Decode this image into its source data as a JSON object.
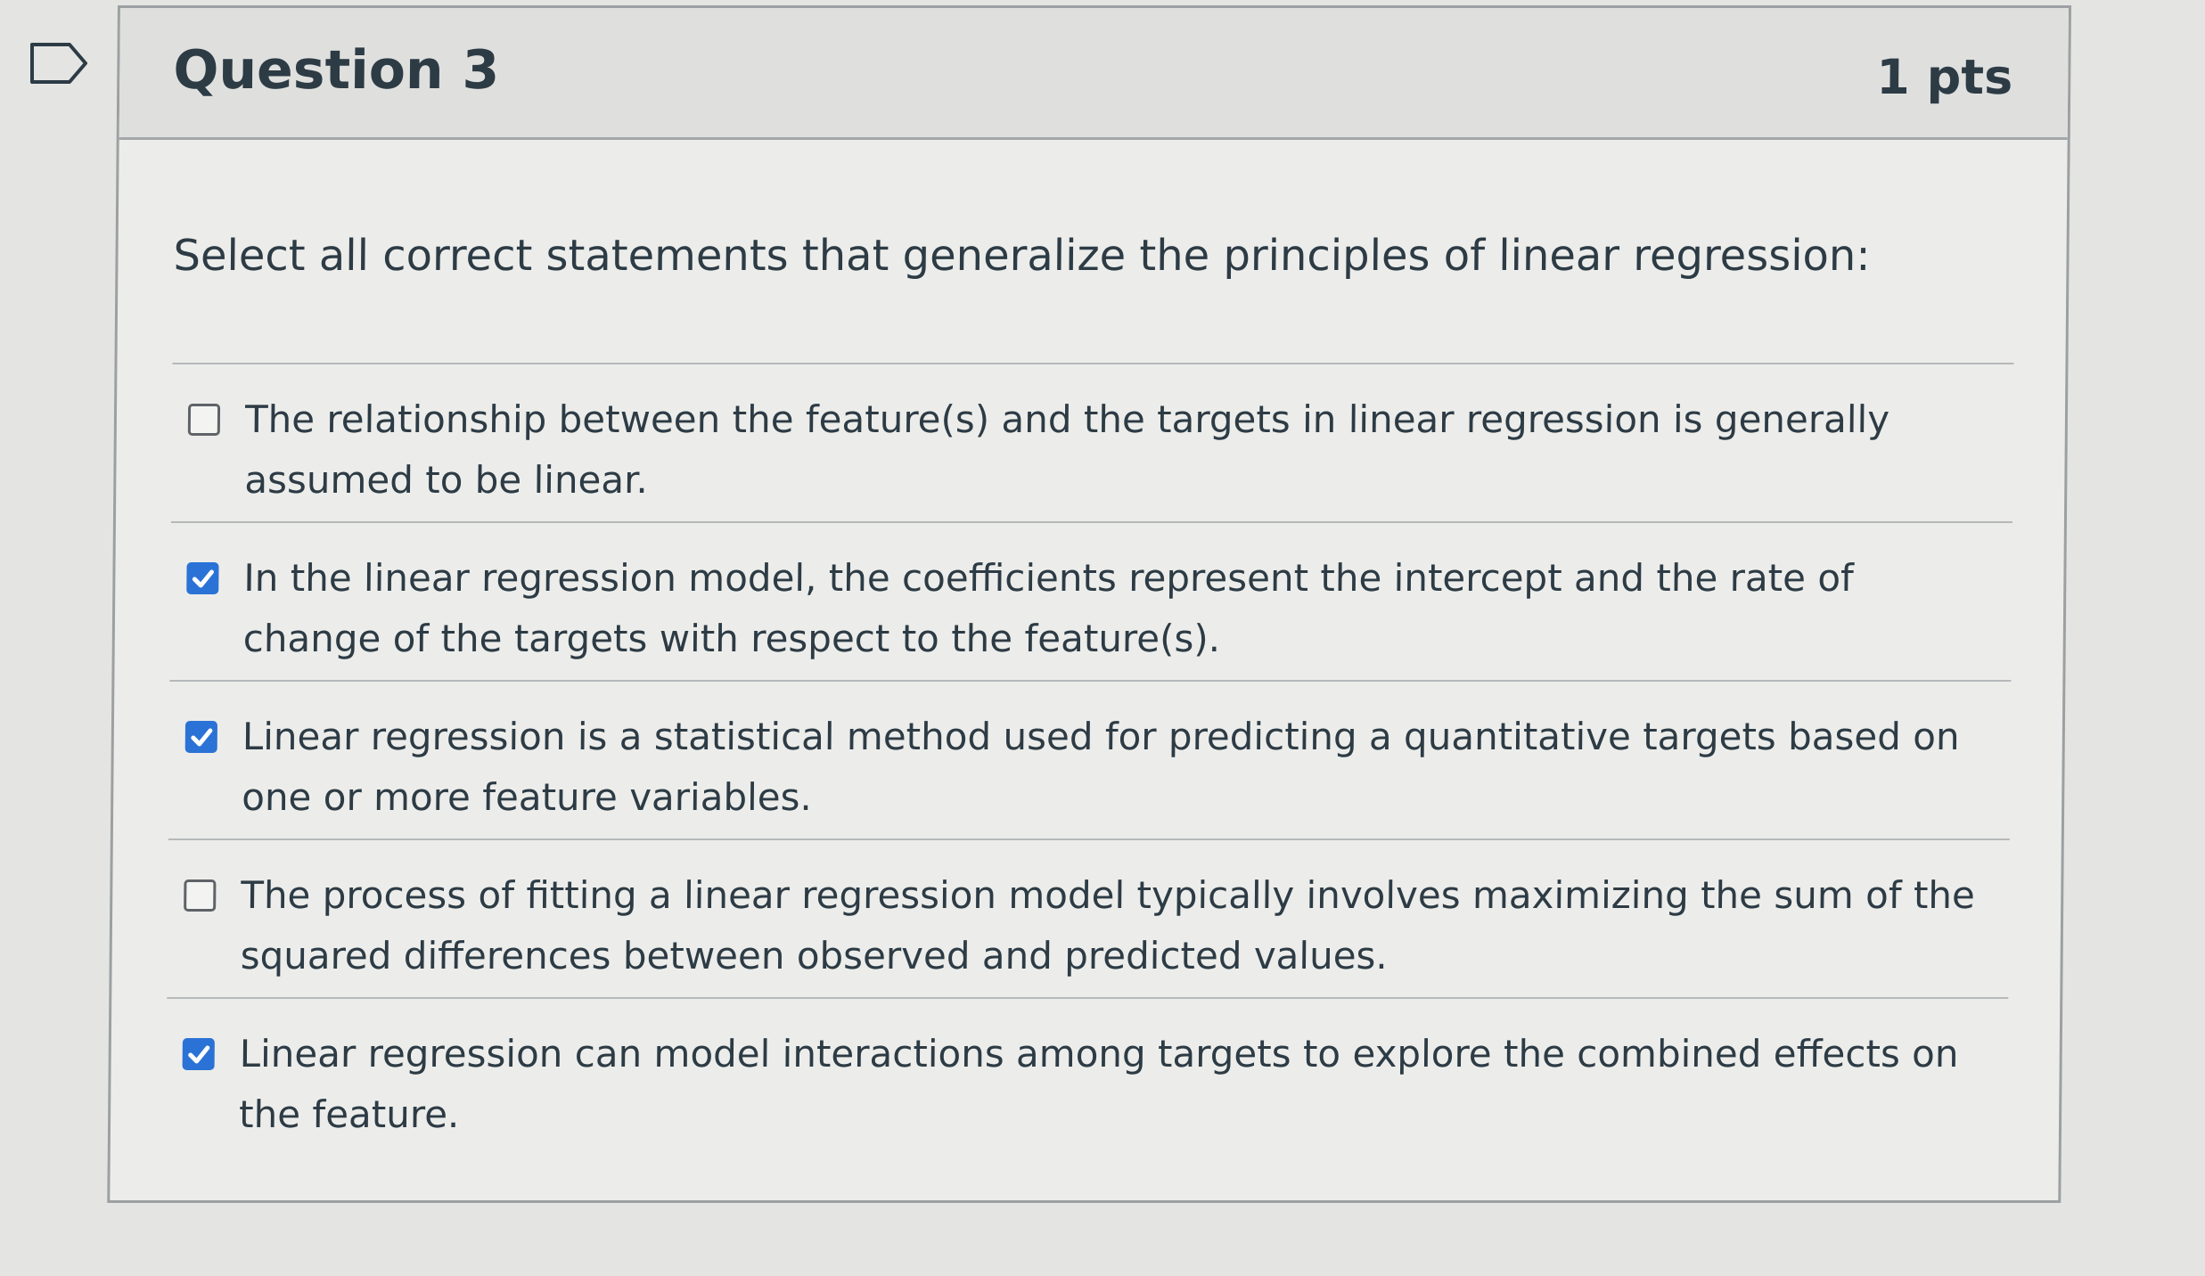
{
  "question": {
    "title": "Question 3",
    "points": "1 pts",
    "prompt": "Select all correct statements that generalize the principles of linear regression:"
  },
  "answers": [
    {
      "text": "The relationship between the feature(s) and the targets in linear regression is generally assumed to be linear.",
      "checked": false
    },
    {
      "text": "In the linear regression model, the coefficients represent the intercept and the rate of change of the targets with respect to the feature(s).",
      "checked": true
    },
    {
      "text": "Linear regression is a statistical method used for predicting a quantitative targets based on one or more feature variables.",
      "checked": true
    },
    {
      "text": "The process of fitting a linear regression model typically involves maximizing the sum of the squared differences between observed and predicted values.",
      "checked": false
    },
    {
      "text": "Linear regression can model interactions among targets to explore the combined effects on the feature.",
      "checked": true
    }
  ],
  "colors": {
    "checkbox_checked": "#2b72d6",
    "text": "#2d3b45",
    "header_bg": "#dfe0de"
  },
  "icons": {
    "flag": "flag-question-icon",
    "check": "checkmark-icon"
  }
}
